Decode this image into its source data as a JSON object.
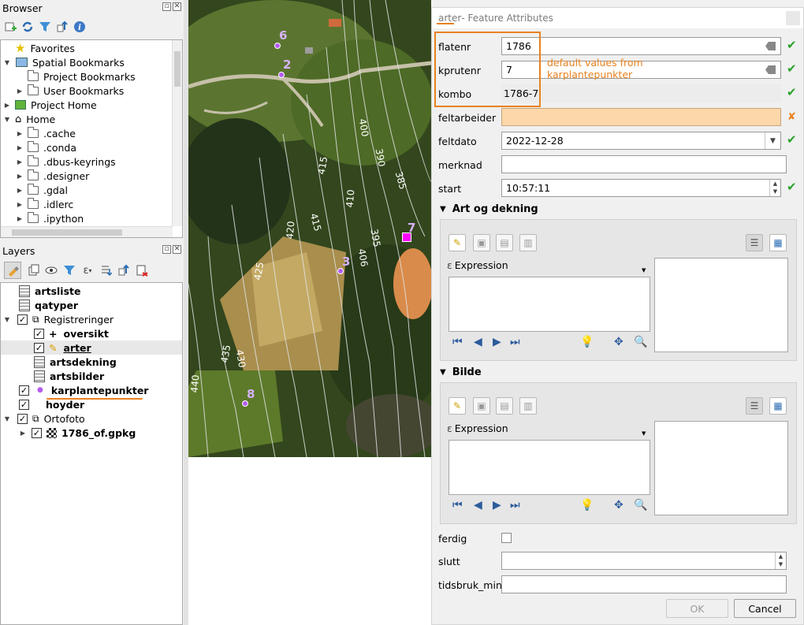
{
  "browser": {
    "title": "Browser",
    "items": [
      {
        "label": "Favorites"
      },
      {
        "label": "Spatial Bookmarks"
      },
      {
        "label": "Project Bookmarks"
      },
      {
        "label": "User Bookmarks"
      },
      {
        "label": "Project Home"
      },
      {
        "label": "Home"
      },
      {
        "label": ".cache"
      },
      {
        "label": ".conda"
      },
      {
        "label": ".dbus-keyrings"
      },
      {
        "label": ".designer"
      },
      {
        "label": ".gdal"
      },
      {
        "label": ".idlerc"
      },
      {
        "label": ".ipython"
      }
    ]
  },
  "layers": {
    "title": "Layers",
    "items": [
      {
        "label": "artsliste"
      },
      {
        "label": "qatyper"
      },
      {
        "label": "Registreringer"
      },
      {
        "label": "oversikt"
      },
      {
        "label": "arter"
      },
      {
        "label": "artsdekning"
      },
      {
        "label": "artsbilder"
      },
      {
        "label": "karplantepunkter"
      },
      {
        "label": "hoyder"
      },
      {
        "label": "Ortofoto"
      },
      {
        "label": "1786_of.gpkg"
      }
    ]
  },
  "map": {
    "contours": [
      "400",
      "390",
      "385",
      "415",
      "410",
      "395",
      "420",
      "415",
      "406",
      "425",
      "435",
      "430",
      "440"
    ],
    "points": [
      "6",
      "2",
      "7",
      "3",
      "8"
    ]
  },
  "dialog": {
    "title_layer": "arter",
    "title_rest": " - Feature Attributes",
    "annotation": "default values from karplantepunkter",
    "fields": {
      "flatenr": {
        "label": "flatenr",
        "value": "1786"
      },
      "kprutenr": {
        "label": "kprutenr",
        "value": "7"
      },
      "kombo": {
        "label": "kombo",
        "value": "1786-7"
      },
      "feltarbeider": {
        "label": "feltarbeider",
        "value": ""
      },
      "feltdato": {
        "label": "feltdato",
        "value": "2022-12-28"
      },
      "merknad": {
        "label": "merknad",
        "value": ""
      },
      "start": {
        "label": "start",
        "value": "10:57:11"
      },
      "ferdig": {
        "label": "ferdig"
      },
      "slutt": {
        "label": "slutt",
        "value": ""
      },
      "tidsbruk_min": {
        "label": "tidsbruk_min",
        "value": ""
      }
    },
    "sections": [
      {
        "title": "Art og dekning",
        "expression_label": "Expression"
      },
      {
        "title": "Bilde",
        "expression_label": "Expression"
      }
    ],
    "buttons": {
      "ok": "OK",
      "cancel": "Cancel"
    }
  },
  "colors": {
    "accent_orange": "#e8821e",
    "ok_green": "#2aa12a",
    "point_purple": "#b35cf0",
    "selected_magenta": "#ff00ff",
    "invalid_field": "#fbd7a9"
  }
}
